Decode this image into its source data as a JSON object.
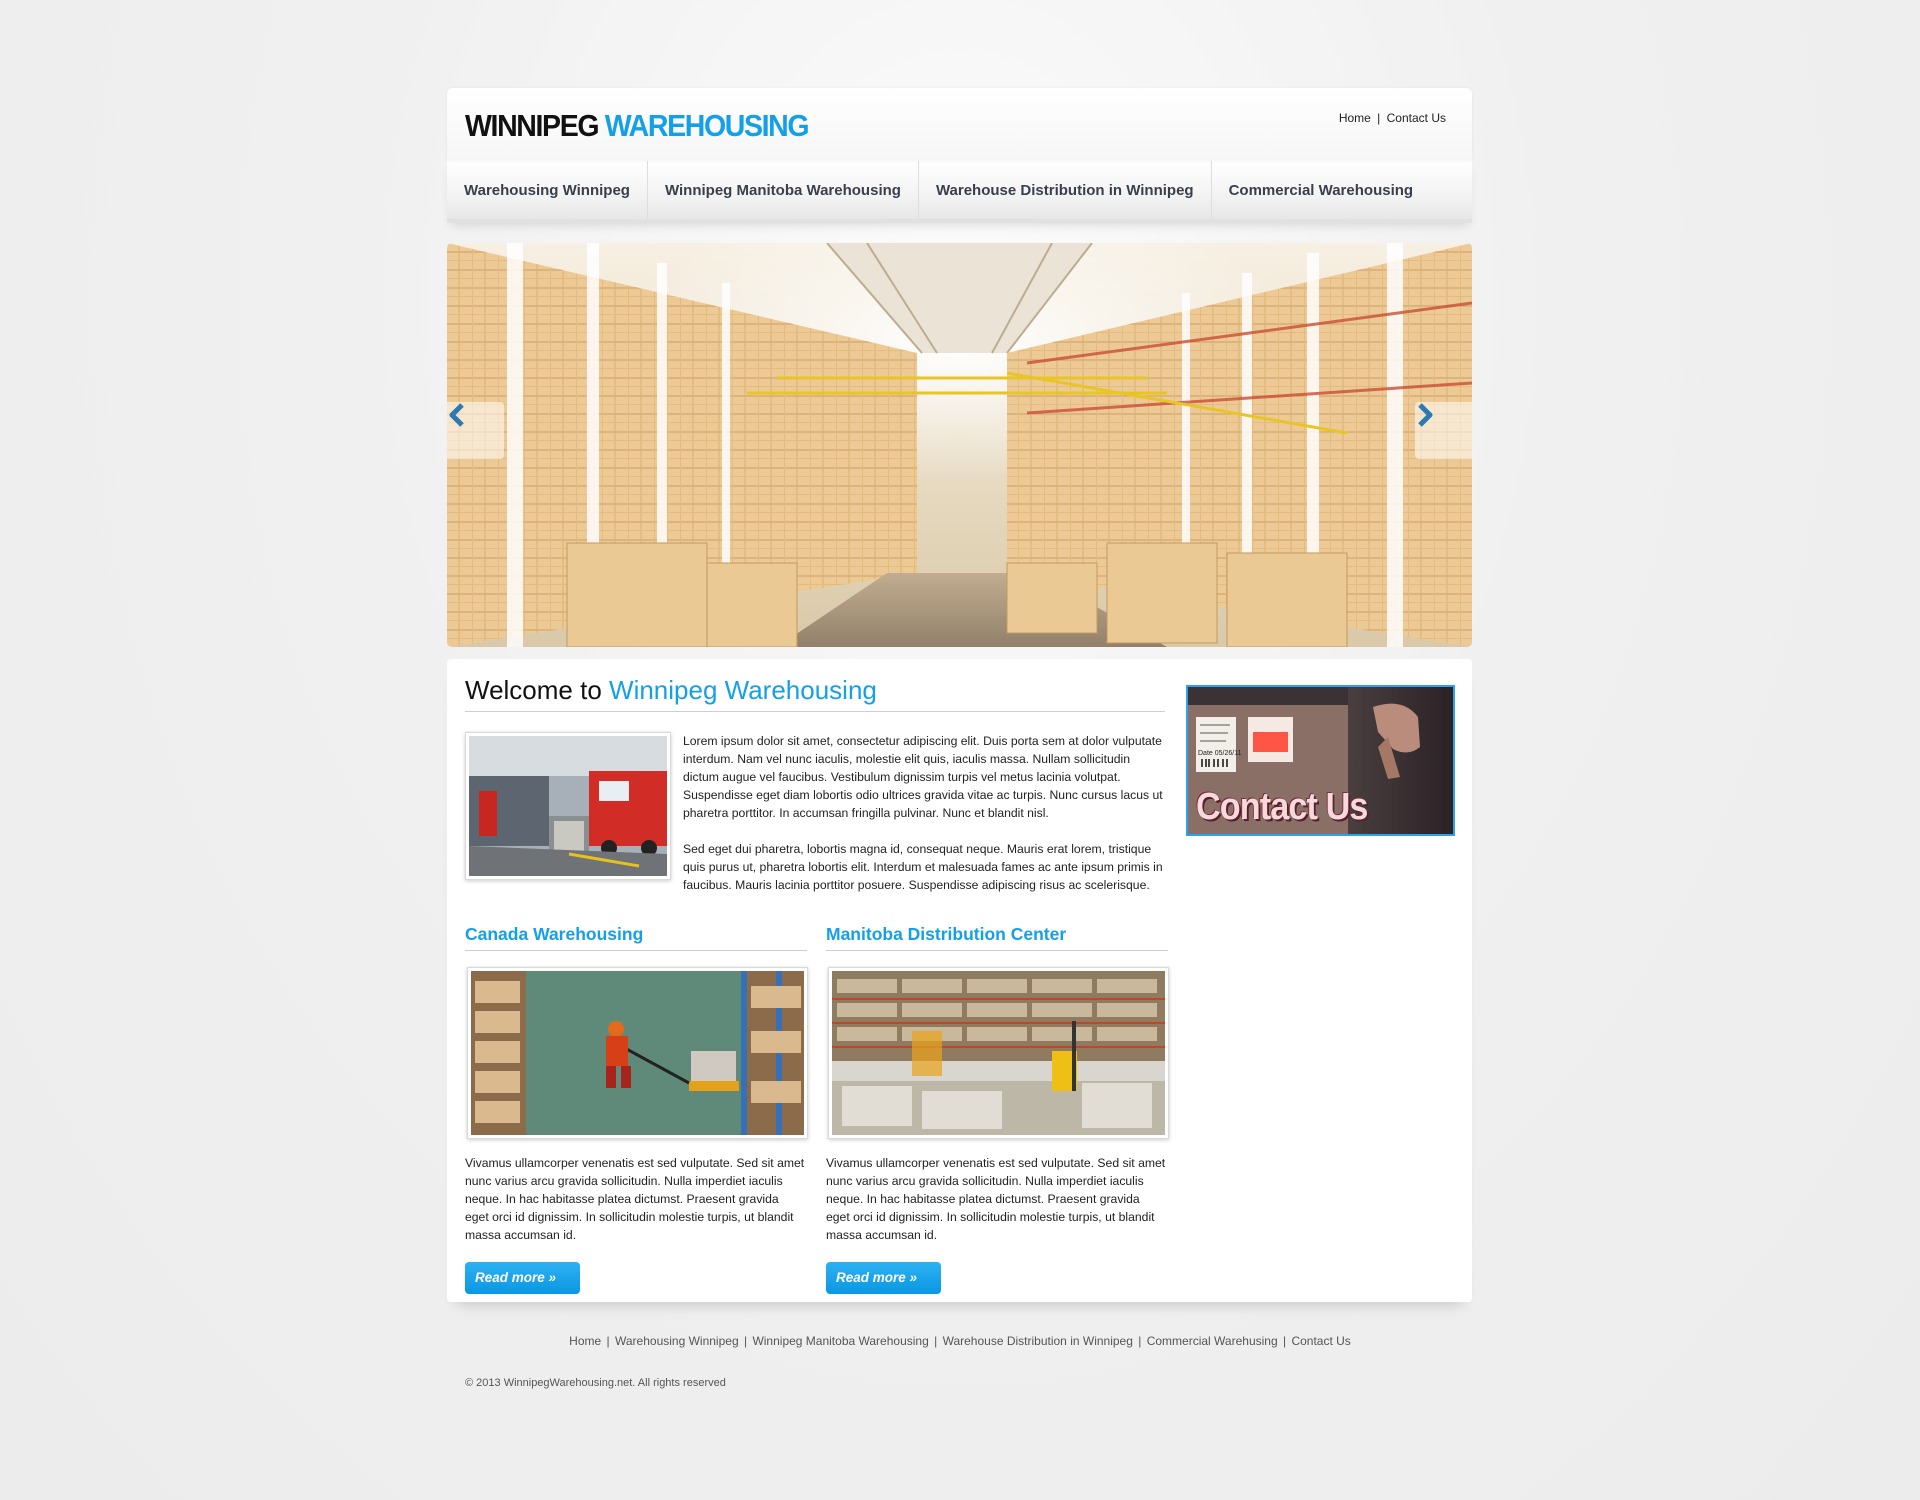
{
  "header": {
    "logo_part1": "WINNIPEG",
    "logo_part2": "WAREHOUSING",
    "toplinks": {
      "home": "Home",
      "separator": "|",
      "contact": "Contact Us"
    }
  },
  "nav": {
    "items": [
      {
        "label": "Warehousing Winnipeg"
      },
      {
        "label": "Winnipeg Manitoba Warehousing"
      },
      {
        "label": "Warehouse Distribution in Winnipeg"
      },
      {
        "label": "Commercial Warehousing"
      }
    ]
  },
  "slider": {
    "prev_icon": "chevron-left-icon",
    "next_icon": "chevron-right-icon"
  },
  "welcome": {
    "title_prefix": "Welcome to",
    "title_highlight": "Winnipeg Warehousing",
    "paragraph1": "Lorem ipsum dolor sit amet, consectetur adipiscing elit. Duis porta sem at dolor vulputate interdum. Nam vel nunc iaculis, molestie elit quis, iaculis massa. Nullam sollicitudin dictum augue vel faucibus. Vestibulum dignissim turpis vel metus lacinia volutpat. Suspendisse eget diam lobortis odio ultrices gravida vitae ac turpis. Nunc cursus lacus ut pharetra porttitor. In accumsan fringilla pulvinar. Nunc et blandit nisl.",
    "paragraph2": "Sed eget dui pharetra, lobortis magna id, consequat neque. Mauris erat lorem, tristique quis purus ut, pharetra lobortis elit. Interdum et malesuada fames ac ante ipsum primis in faucibus. Mauris lacinia porttitor posuere. Suspendisse adipiscing risus ac scelerisque."
  },
  "columns": [
    {
      "title": "Canada Warehousing",
      "text": "Vivamus ullamcorper venenatis est sed vulputate. Sed sit amet nunc varius arcu gravida sollicitudin. Nulla imperdiet iaculis neque. In hac habitasse platea dictumst. Praesent gravida eget orci id dignissim. In sollicitudin molestie turpis, ut blandit massa accumsan id.",
      "button": "Read more »"
    },
    {
      "title": "Manitoba Distribution Center",
      "text": "Vivamus ullamcorper venenatis est sed vulputate. Sed sit amet nunc varius arcu gravida sollicitudin. Nulla imperdiet iaculis neque. In hac habitasse platea dictumst. Praesent gravida eget orci id dignissim. In sollicitudin molestie turpis, ut blandit massa accumsan id.",
      "button": "Read more »"
    }
  ],
  "sidebar": {
    "banner_text": "Contact Us",
    "label_date": "Date 05/26/11"
  },
  "footer": {
    "links": [
      "Home",
      "Warehousing Winnipeg",
      "Winnipeg Manitoba Warehousing",
      "Warehouse Distribution in Winnipeg",
      "Commercial Warehusing",
      "Contact Us"
    ],
    "separator": "|",
    "copyright": "© 2013 WinnipegWarehousing.net. All rights reserved"
  },
  "colors": {
    "accent": "#14a0e8",
    "nav_text": "#3a3f4e",
    "button": "#0a97e4"
  }
}
